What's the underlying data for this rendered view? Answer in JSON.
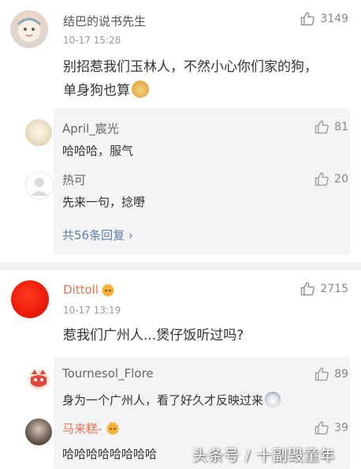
{
  "comments": [
    {
      "user": "结巴的说书先生",
      "time": "10-17 15:28",
      "likes": "3149",
      "text_line1": "别招惹我们玉林人，不然小心你们家的狗，",
      "text_line2": "单身狗也算",
      "replies": [
        {
          "user": "April_宸光",
          "text": "哈哈哈，服气",
          "likes": "81"
        },
        {
          "user": "热可",
          "text": "先来一句，捻嘢",
          "likes": "20"
        }
      ],
      "more_replies": "共56条回复 ›"
    },
    {
      "user": "Dittoll",
      "time": "10-17 13:19",
      "likes": "2715",
      "text_line1": "惹我们广州人...煲仔饭听过吗?",
      "replies": [
        {
          "user": "Tournesol_Flore",
          "text": "身为一个广州人，看了好久才反映过来",
          "likes": "89"
        },
        {
          "user": "马来糕-",
          "text": "哈哈哈哈哈哈哈哈",
          "likes": "39"
        }
      ]
    }
  ],
  "watermark": "头条号 / 十副毁童年",
  "icons": {
    "like": "thumbs-up-icon",
    "doge_emoji": "doge-emoji-icon",
    "vip_badge": "vip-badge-icon"
  },
  "colors": {
    "orange_name": "#eb7350",
    "link": "#5d7fa8"
  }
}
